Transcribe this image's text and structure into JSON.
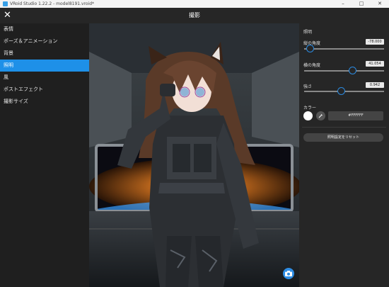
{
  "window": {
    "title": "VRoid Studio 1.22.2 - model8191.vroid*",
    "minimize": "–",
    "maximize": "□",
    "close": "✕"
  },
  "header": {
    "close_icon": "✕",
    "title": "撮影"
  },
  "sidebar": {
    "items": [
      {
        "label": "表情",
        "active": false
      },
      {
        "label": "ポーズ＆アニメーション",
        "active": false
      },
      {
        "label": "背景",
        "active": false
      },
      {
        "label": "照明",
        "active": true
      },
      {
        "label": "風",
        "active": false
      },
      {
        "label": "ポストエフェクト",
        "active": false
      },
      {
        "label": "撮影サイズ",
        "active": false
      }
    ]
  },
  "panel": {
    "section_title": "照明",
    "vertical_angle": {
      "label": "縦の角度",
      "value": "-78.000",
      "fraction": 0.08
    },
    "horizontal_angle": {
      "label": "横の角度",
      "value": "41.054",
      "fraction": 0.61
    },
    "intensity": {
      "label": "強さ",
      "value": "0.942",
      "fraction": 0.47
    },
    "color_label": "カラー",
    "color_hex": "#FFFFFF",
    "reset_label": "照明設定をリセット"
  },
  "colors": {
    "accent": "#1e90e8",
    "panel_bg": "#262626",
    "sidebar_bg": "#1f1f1f"
  }
}
